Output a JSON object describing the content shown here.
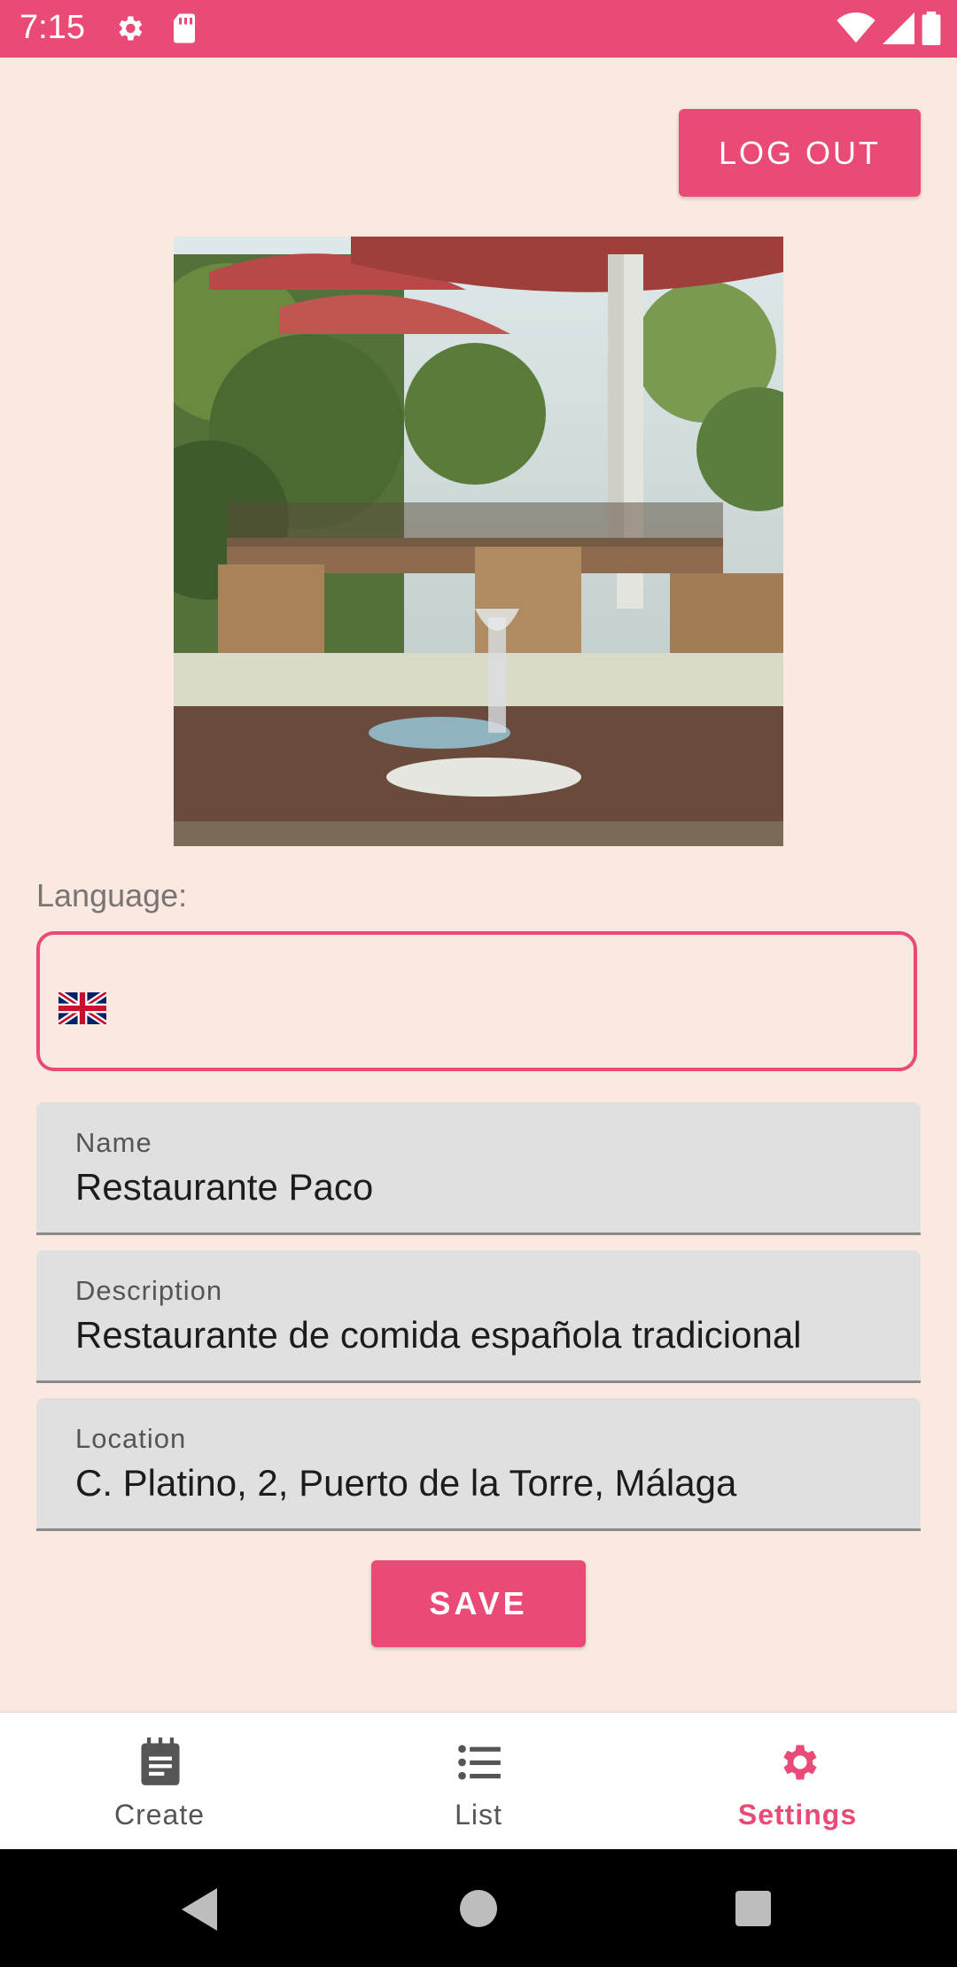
{
  "status_bar": {
    "time": "7:15"
  },
  "header": {
    "logout_label": "LOG OUT"
  },
  "photo": {
    "edit_icon": "edit-icon"
  },
  "language": {
    "label": "Language:",
    "selected": "uk-flag"
  },
  "fields": {
    "name": {
      "label": "Name",
      "value": "Restaurante Paco"
    },
    "description": {
      "label": "Description",
      "value": "Restaurante de comida española tradicional"
    },
    "location": {
      "label": "Location",
      "value": "C. Platino, 2, Puerto de la Torre, Málaga"
    }
  },
  "save_label": "SAVE",
  "bottom_nav": {
    "items": [
      {
        "label": "Create",
        "icon": "clipboard-icon"
      },
      {
        "label": "List",
        "icon": "list-icon"
      },
      {
        "label": "Settings",
        "icon": "gear-icon",
        "active": true
      }
    ]
  },
  "colors": {
    "accent": "#e94b76",
    "fab": "#ee8a14",
    "background": "#f9e9e0"
  }
}
